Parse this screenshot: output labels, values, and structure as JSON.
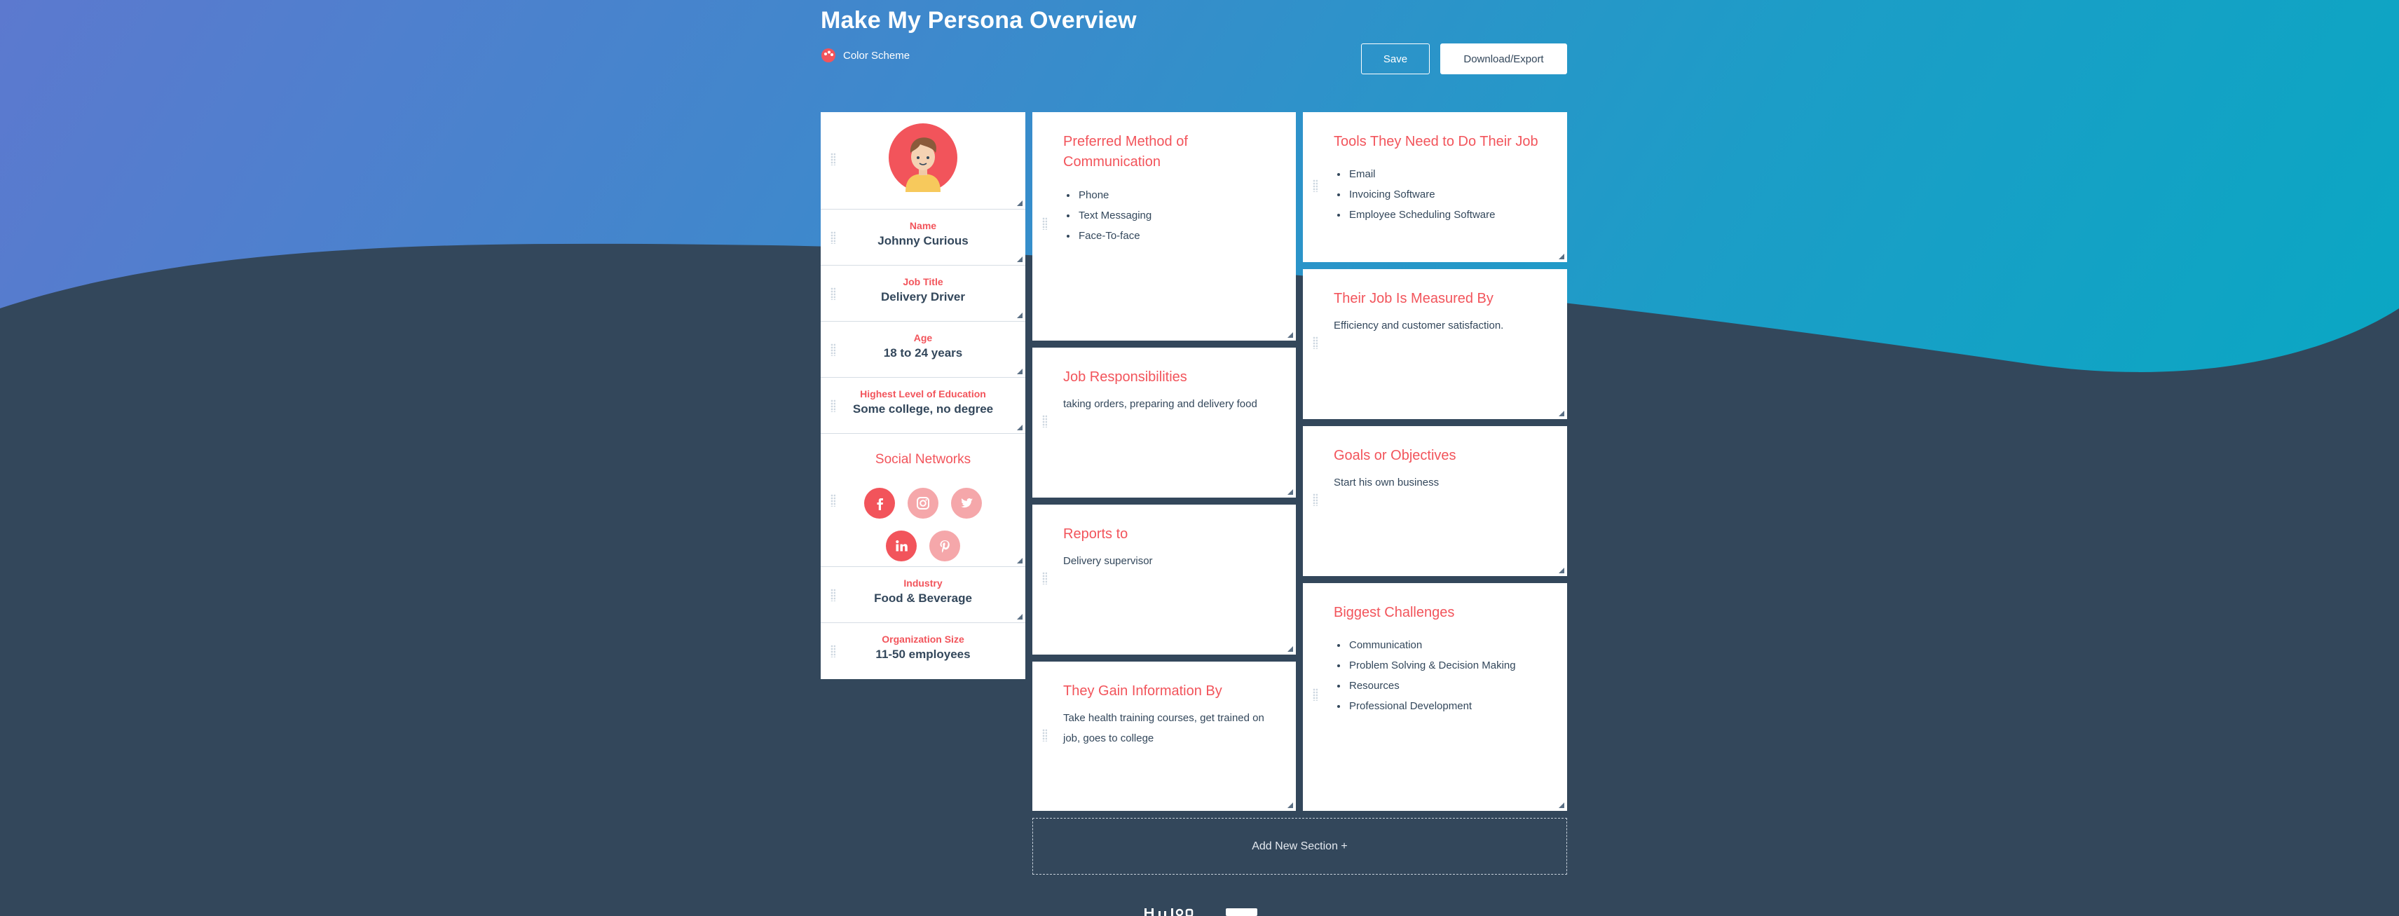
{
  "header": {
    "title": "Make My Persona Overview",
    "color_scheme_label": "Color Scheme",
    "save_label": "Save",
    "export_label": "Download/Export"
  },
  "profile": {
    "avatar": "persona-avatar",
    "fields": [
      {
        "label": "Name",
        "value": "Johnny Curious"
      },
      {
        "label": "Job Title",
        "value": "Delivery Driver"
      },
      {
        "label": "Age",
        "value": "18 to 24 years"
      },
      {
        "label": "Highest Level of Education",
        "value": "Some college, no degree"
      }
    ],
    "social": {
      "title": "Social Networks",
      "networks": [
        {
          "name": "facebook-icon",
          "active": true
        },
        {
          "name": "instagram-icon",
          "active": false
        },
        {
          "name": "twitter-icon",
          "active": false
        },
        {
          "name": "linkedin-icon",
          "active": true
        },
        {
          "name": "pinterest-icon",
          "active": false
        }
      ]
    },
    "extra_fields": [
      {
        "label": "Industry",
        "value": "Food & Beverage"
      },
      {
        "label": "Organization Size",
        "value": "11-50 employees"
      }
    ]
  },
  "sections": {
    "communication": {
      "title": "Preferred Method of Communication",
      "items": [
        "Phone",
        "Text Messaging",
        "Face-To-face"
      ]
    },
    "responsibilities": {
      "title": "Job Responsibilities",
      "text": "taking orders, preparing and delivery food"
    },
    "reports_to": {
      "title": "Reports to",
      "text": "Delivery supervisor"
    },
    "information": {
      "title": "They Gain Information By",
      "text": "Take health training courses, get trained on job, goes to college"
    },
    "tools": {
      "title": "Tools They Need to Do Their Job",
      "items": [
        "Email",
        "Invoicing Software",
        "Employee Scheduling Software"
      ]
    },
    "measured": {
      "title": "Their Job Is Measured By",
      "text": "Efficiency and customer satisfaction."
    },
    "goals": {
      "title": "Goals or Objectives",
      "text": "Start his own business"
    },
    "challenges": {
      "title": "Biggest Challenges",
      "items": [
        "Communication",
        "Problem Solving & Decision Making",
        "Resources",
        "Professional Development"
      ]
    }
  },
  "add_section_label": "Add New Section +",
  "colors": {
    "accent": "#f2545b",
    "dark": "#33475b",
    "gradient_start": "#5c79cf",
    "gradient_end": "#0aa7c3"
  }
}
